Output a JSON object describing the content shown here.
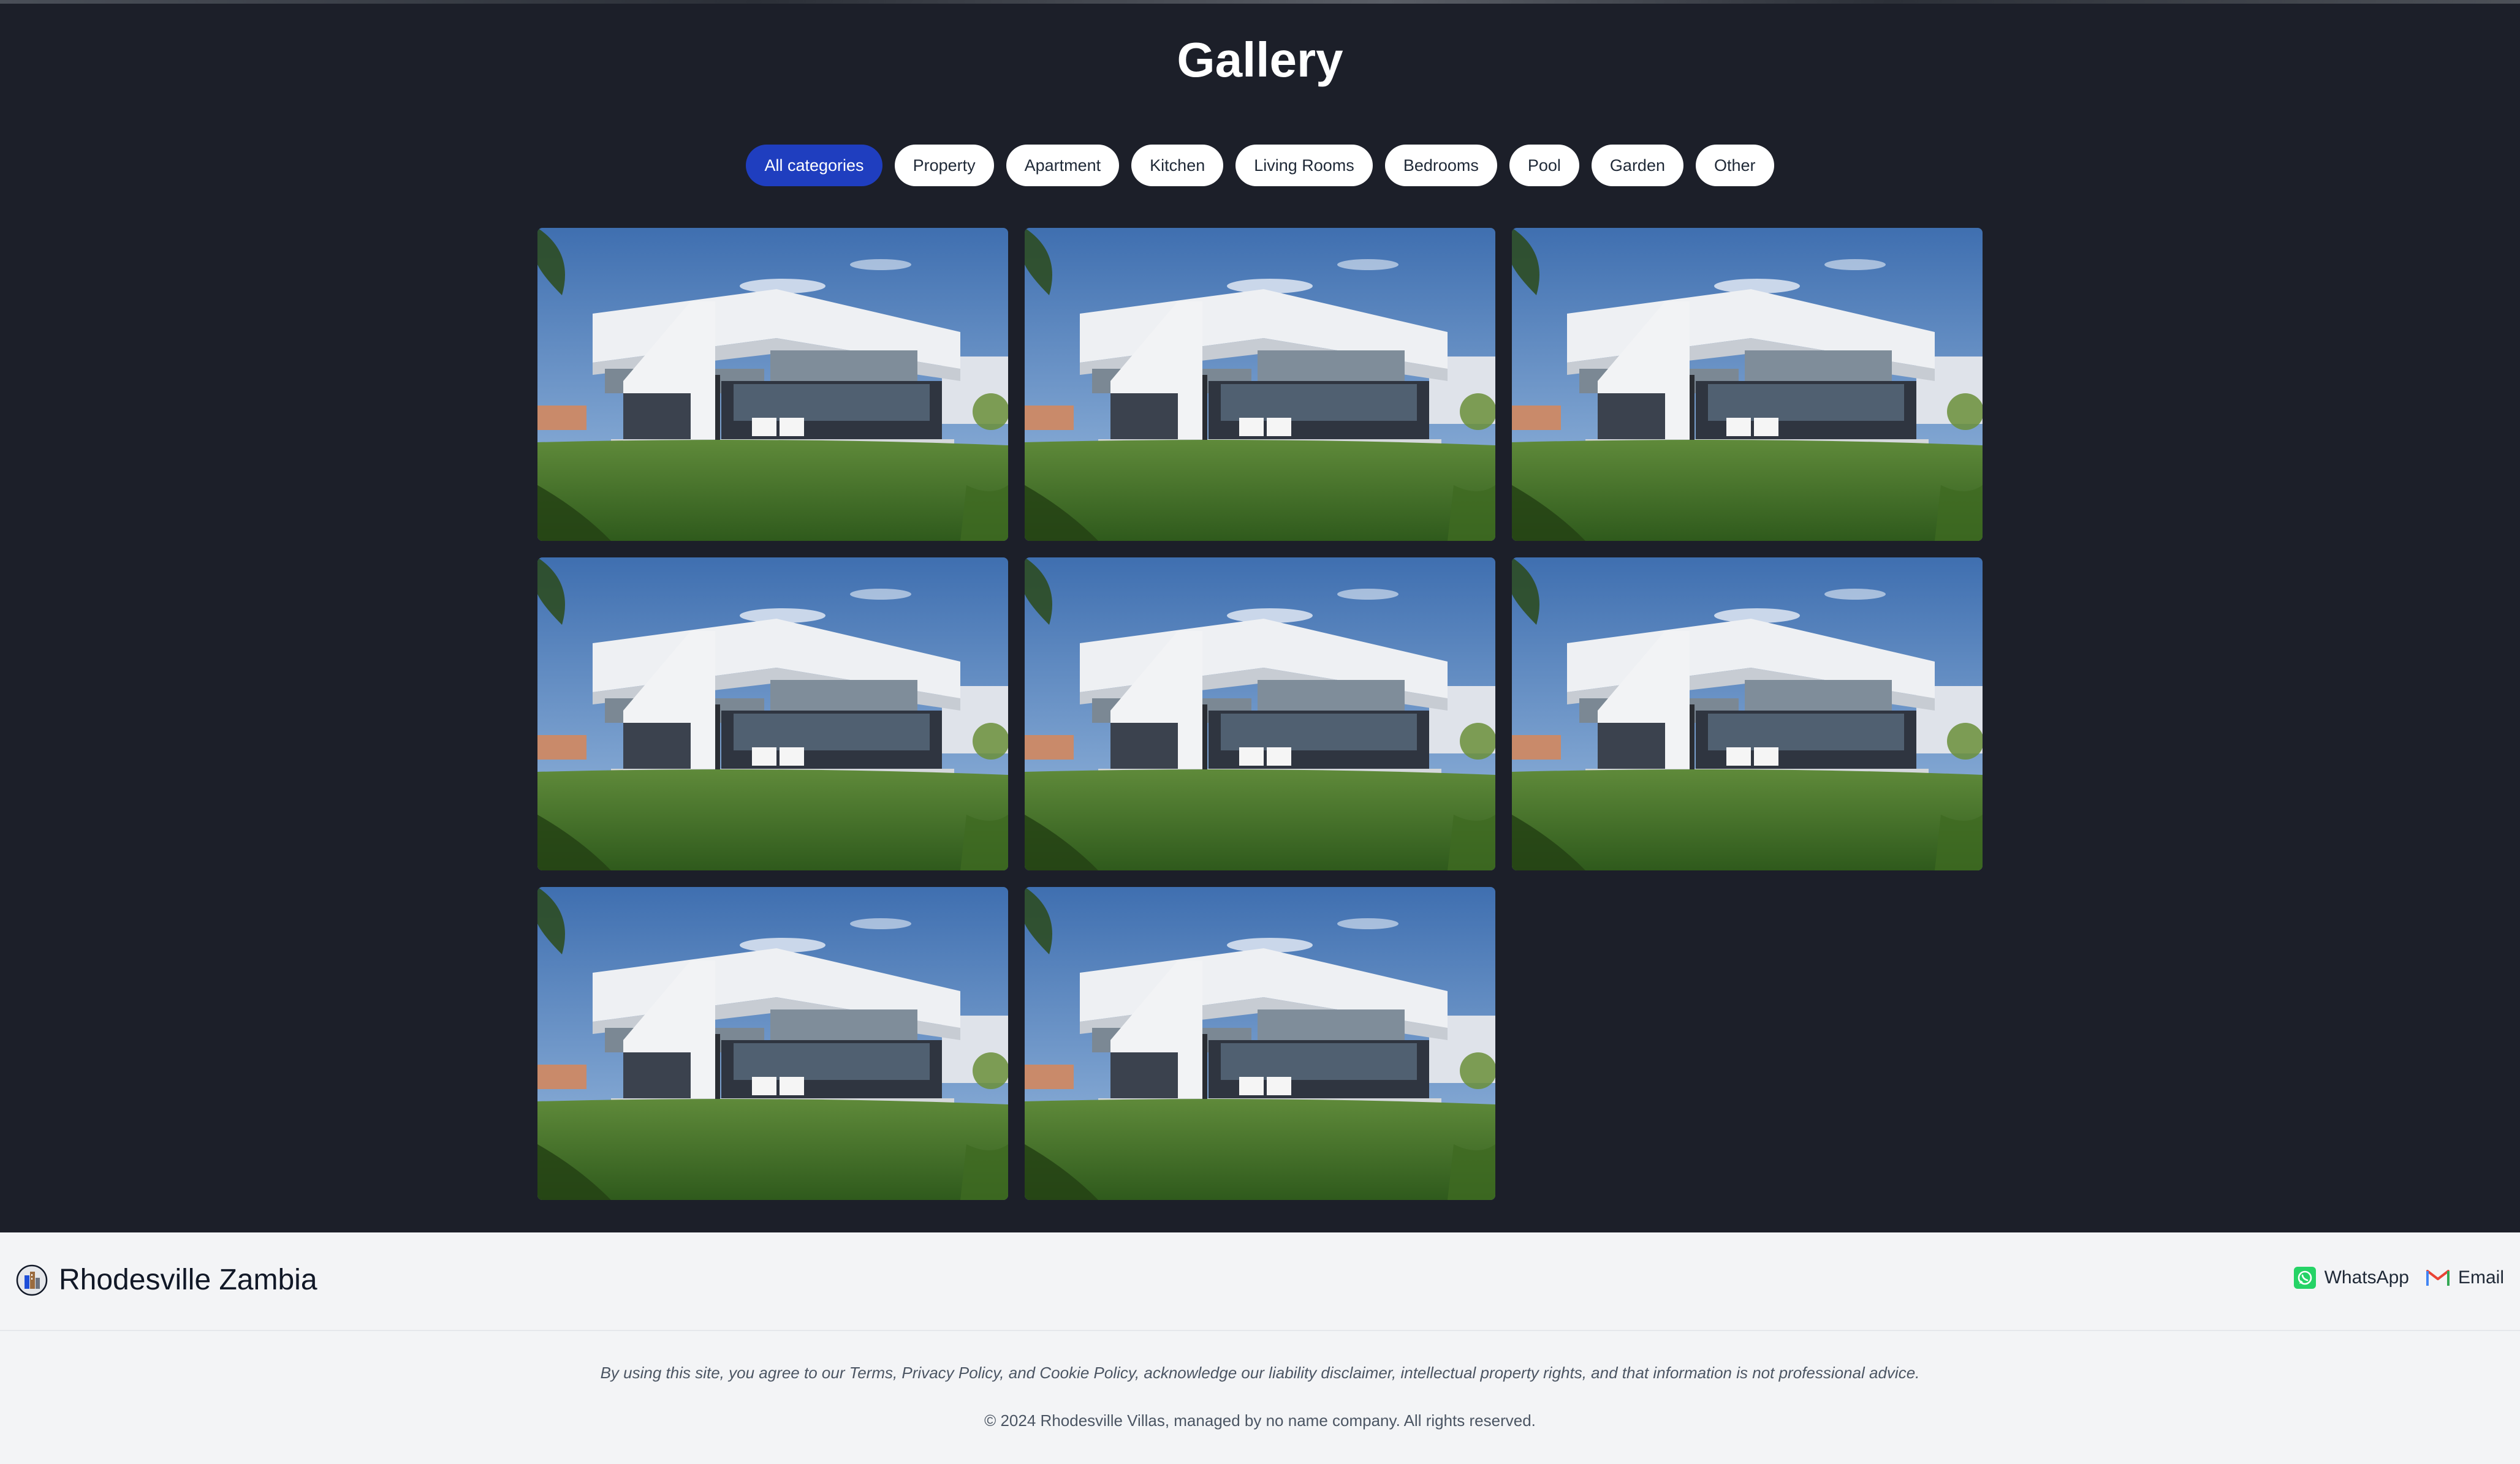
{
  "gallery": {
    "title": "Gallery",
    "filters": [
      {
        "label": "All categories",
        "active": true
      },
      {
        "label": "Property",
        "active": false
      },
      {
        "label": "Apartment",
        "active": false
      },
      {
        "label": "Kitchen",
        "active": false
      },
      {
        "label": "Living Rooms",
        "active": false
      },
      {
        "label": "Bedrooms",
        "active": false
      },
      {
        "label": "Pool",
        "active": false
      },
      {
        "label": "Garden",
        "active": false
      },
      {
        "label": "Other",
        "active": false
      }
    ],
    "photo_count": 8
  },
  "footer": {
    "brand_name": "Rhodesville Zambia",
    "whatsapp_label": "WhatsApp",
    "email_label": "Email",
    "legal_text": "By using this site, you agree to our Terms, Privacy Policy, and Cookie Policy, acknowledge our liability disclaimer, intellectual property rights, and that information is not professional advice.",
    "copyright": "© 2024 Rhodesville Villas, managed by no name company. All rights reserved."
  },
  "colors": {
    "page_bg": "#1c1f29",
    "active_chip": "#1f3ebf",
    "footer_bg": "#f3f4f6",
    "whatsapp": "#25d366",
    "gmail": "#ea4335"
  },
  "icons": [
    "logo-icon",
    "whatsapp-icon",
    "email-icon"
  ]
}
